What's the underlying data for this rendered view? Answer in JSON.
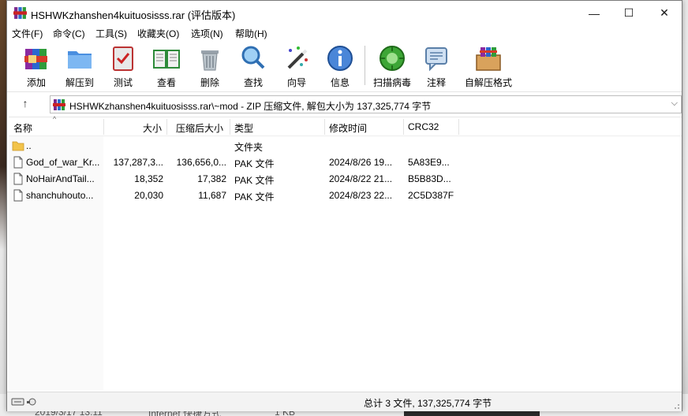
{
  "window": {
    "title": "HSHWKzhanshen4kuituosisss.rar (评估版本)",
    "min_glyph": "—",
    "max_glyph": "☐",
    "close_glyph": "✕"
  },
  "menu": [
    "文件(F)",
    "命令(C)",
    "工具(S)",
    "收藏夹(O)",
    "选项(N)",
    "帮助(H)"
  ],
  "toolbar": [
    {
      "label": "添加",
      "icon": "add-archive-icon"
    },
    {
      "label": "解压到",
      "icon": "extract-to-icon"
    },
    {
      "label": "测试",
      "icon": "test-icon"
    },
    {
      "label": "查看",
      "icon": "view-icon"
    },
    {
      "label": "删除",
      "icon": "delete-icon"
    },
    {
      "label": "查找",
      "icon": "find-icon"
    },
    {
      "label": "向导",
      "icon": "wizard-icon"
    },
    {
      "label": "信息",
      "icon": "info-icon"
    },
    {
      "label": "扫描病毒",
      "icon": "virus-scan-icon"
    },
    {
      "label": "注释",
      "icon": "comment-icon"
    },
    {
      "label": "自解压格式",
      "icon": "sfx-icon"
    }
  ],
  "address": {
    "up_glyph": "↑",
    "path": "HSHWKzhanshen4kuituosisss.rar\\~mod - ZIP 压缩文件, 解包大小为 137,325,774 字节",
    "dropdown_glyph": "⌵"
  },
  "columns": {
    "name": "名称",
    "size": "大小",
    "packed": "压缩后大小",
    "type": "类型",
    "modified": "修改时间",
    "crc": "CRC32"
  },
  "files": [
    {
      "name": "..",
      "size": "",
      "packed": "",
      "type": "文件夹",
      "modified": "",
      "crc": "",
      "kind": "folder"
    },
    {
      "name": "God_of_war_Kr...",
      "size": "137,287,3...",
      "packed": "136,656,0...",
      "type": "PAK 文件",
      "modified": "2024/8/26 19...",
      "crc": "5A83E9...",
      "kind": "file"
    },
    {
      "name": "NoHairAndTail...",
      "size": "18,352",
      "packed": "17,382",
      "type": "PAK 文件",
      "modified": "2024/8/22 21...",
      "crc": "B5B83D...",
      "kind": "file"
    },
    {
      "name": "shanchuhouto...",
      "size": "20,030",
      "packed": "11,687",
      "type": "PAK 文件",
      "modified": "2024/8/23 22...",
      "crc": "2C5D387F",
      "kind": "file"
    }
  ],
  "status": {
    "summary": "总计 3 文件, 137,325,774 字节"
  },
  "background": {
    "date": "2019/3/17 13:11",
    "type": "Internet 快捷方式",
    "size": "1 KB"
  }
}
